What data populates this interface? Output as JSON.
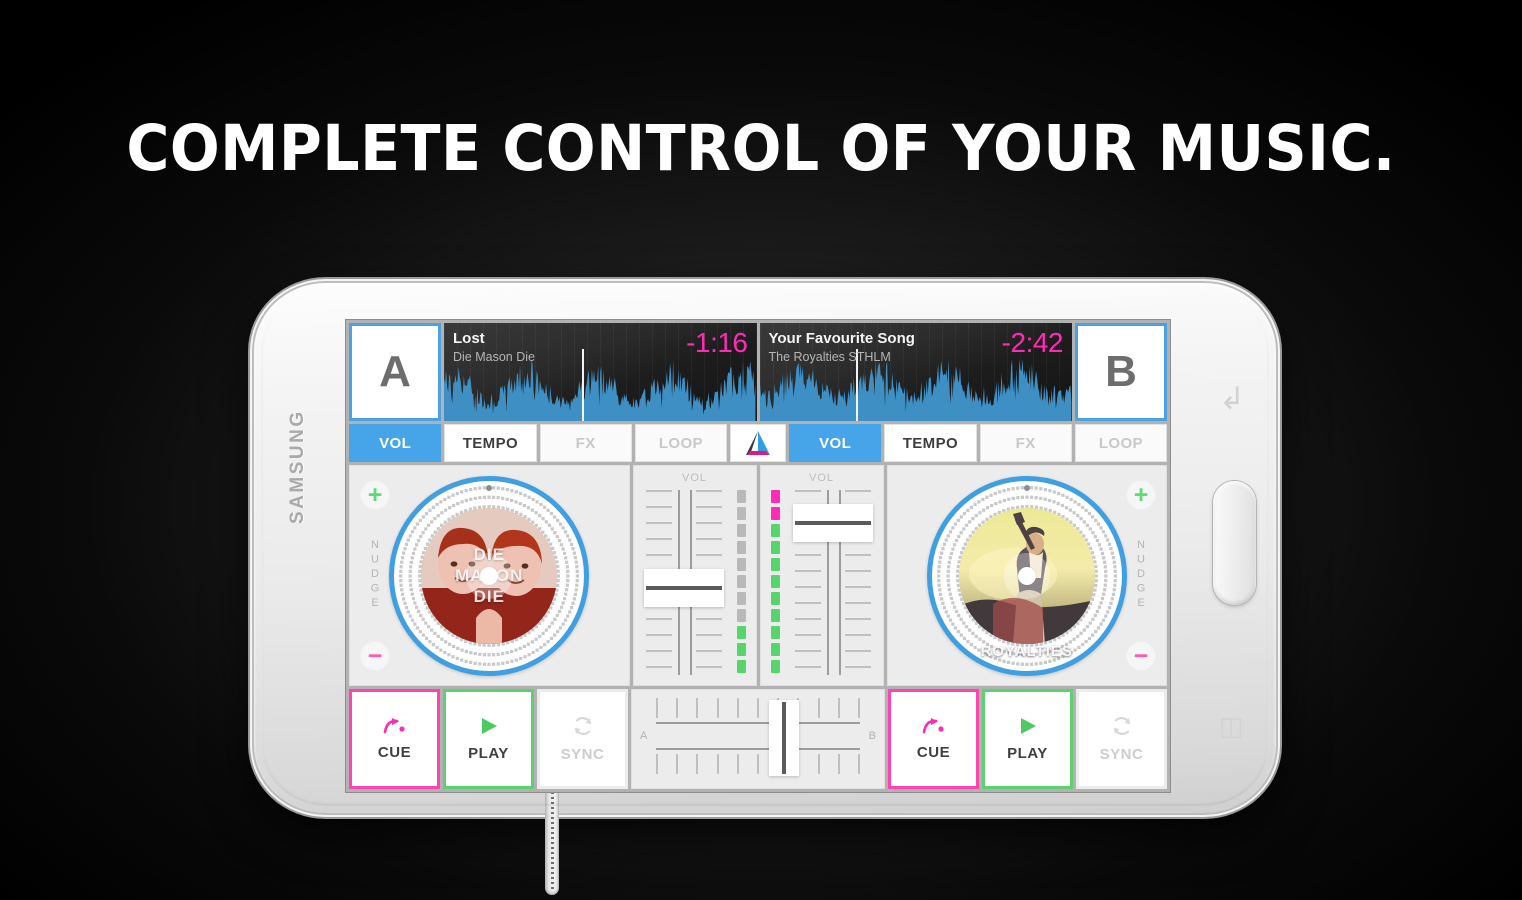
{
  "headline": "COMPLETE CONTROL OF YOUR MUSIC.",
  "device": {
    "brand": "SAMSUNG",
    "back_key_icon": "back-arrow-icon",
    "menu_key_icon": "menu-icon"
  },
  "colors": {
    "accent_blue": "#46a5e8",
    "accent_pink": "#ff2bb5",
    "accent_green": "#57d46c",
    "waveform_blue": "#3d8fc4",
    "screen_bg": "#b2b2b2",
    "panel_bg": "#ececec"
  },
  "app": {
    "center_logo_icon": "edjing-triangle-logo-icon",
    "decks": [
      {
        "id": "A",
        "letter": "A",
        "track_title": "Lost",
        "track_artist": "Die Mason Die",
        "time_remaining": "-1:16",
        "art_label_lines": [
          "DIE",
          "MASON",
          "DIE"
        ],
        "nudge_label": "NUDGE",
        "nudge_plus": "+",
        "nudge_minus": "−",
        "tabs": [
          {
            "label": "VOL",
            "state": "active"
          },
          {
            "label": "TEMPO",
            "state": "normal"
          },
          {
            "label": "FX",
            "state": "disabled"
          },
          {
            "label": "LOOP",
            "state": "disabled"
          }
        ],
        "transport": [
          {
            "label": "CUE",
            "icon": "cue-icon",
            "style": "cue"
          },
          {
            "label": "PLAY",
            "icon": "play-icon",
            "style": "play"
          },
          {
            "label": "SYNC",
            "icon": "sync-icon",
            "style": "sync"
          }
        ],
        "volume_label": "VOL",
        "volume_percent": 48,
        "vu_total_segments": 11,
        "vu_green_segments": 3,
        "vu_pink_segments": 0
      },
      {
        "id": "B",
        "letter": "B",
        "track_title": "Your Favourite Song",
        "track_artist": "The Royalties STHLM",
        "time_remaining": "-2:42",
        "art_label_lines": [
          "ROYALTIES"
        ],
        "nudge_label": "NUDGE",
        "nudge_plus": "+",
        "nudge_minus": "−",
        "tabs": [
          {
            "label": "VOL",
            "state": "active"
          },
          {
            "label": "TEMPO",
            "state": "normal"
          },
          {
            "label": "FX",
            "state": "disabled"
          },
          {
            "label": "LOOP",
            "state": "disabled"
          }
        ],
        "transport": [
          {
            "label": "CUE",
            "icon": "cue-icon",
            "style": "cue"
          },
          {
            "label": "PLAY",
            "icon": "play-icon",
            "style": "play"
          },
          {
            "label": "SYNC",
            "icon": "sync-icon",
            "style": "sync"
          }
        ],
        "volume_label": "VOL",
        "volume_percent": 92,
        "vu_total_segments": 11,
        "vu_green_segments": 9,
        "vu_pink_segments": 2
      }
    ],
    "crossfader": {
      "left_label": "A",
      "right_label": "B",
      "position_percent": 62
    }
  }
}
